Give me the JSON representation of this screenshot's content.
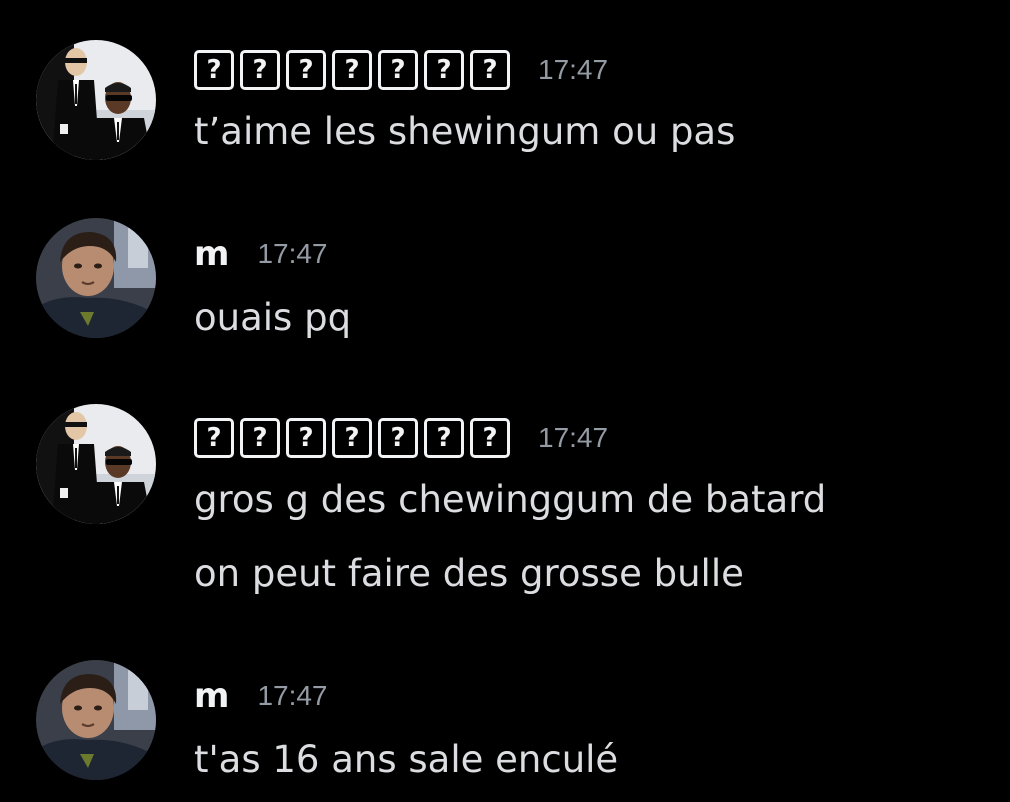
{
  "messages": [
    {
      "author": "?",
      "author_glyphs": [
        "?",
        "?",
        "?",
        "?",
        "?",
        "?",
        "?"
      ],
      "avatar": "men-in-black-avatar",
      "time": "17:47",
      "lines": [
        "t’aime les shewingum ou pas"
      ]
    },
    {
      "author": "m",
      "avatar": "boy-portrait-avatar",
      "time": "17:47",
      "lines": [
        "ouais pq"
      ]
    },
    {
      "author": "?",
      "author_glyphs": [
        "?",
        "?",
        "?",
        "?",
        "?",
        "?",
        "?"
      ],
      "avatar": "men-in-black-avatar",
      "time": "17:47",
      "lines": [
        "gros g des chewinggum de batard",
        "on peut faire des grosse bulle"
      ]
    },
    {
      "author": "m",
      "avatar": "boy-portrait-avatar",
      "time": "17:47",
      "lines": [
        "t'as 16 ans sale enculé"
      ]
    }
  ],
  "colors": {
    "background": "#000000",
    "username": "#f2f3f5",
    "message_text": "#dcdde1",
    "timestamp": "#949ba4"
  }
}
